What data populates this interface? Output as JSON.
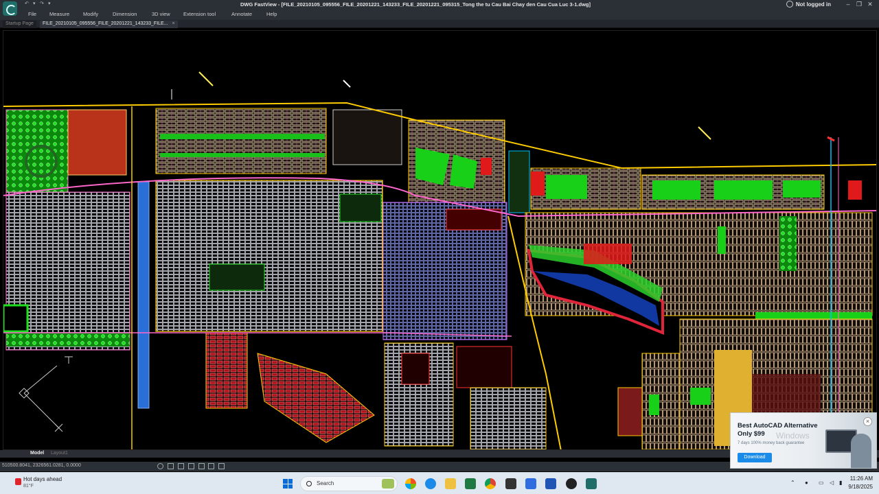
{
  "window": {
    "title": "DWG FastView - [FILE_20210105_095556_FILE_20201221_143233_FILE_20201221_095315_Tong the tu Cau Bai Chay den Cau Cua Luc 3-1.dwg]",
    "user_status": "Not logged in"
  },
  "menu": {
    "items": [
      "File",
      "Measure",
      "Modify",
      "Dimension",
      "3D view",
      "Extension tool",
      "Annotate",
      "Help"
    ]
  },
  "tabs": {
    "startup": "Startup Page",
    "active": "FILE_20210105_095556_FILE_20201221_143233_FILE...",
    "close_glyph": "×"
  },
  "layout_tabs": {
    "model": "Model",
    "layout": "Layout1"
  },
  "status": {
    "coordinates": "510500.8041, 2326561.0281, 0.0000"
  },
  "ad": {
    "title": "Best AutoCAD Alternative",
    "price": "Only $99",
    "watermark": "Windows",
    "subtitle": "7 days 100% money back guarantee",
    "button": "Download",
    "close_glyph": "×"
  },
  "taskbar": {
    "weather_title": "Hot days ahead",
    "weather_temp": "81°F",
    "search_placeholder": "Search",
    "time": "11:26 AM",
    "date": "9/18/2025"
  },
  "colors": {
    "cad_background": "#000000",
    "chrome": "#2b2f36",
    "taskbar": "#dfe7f1",
    "accent_blue": "#1a8be8"
  },
  "icons": [
    "app-logo-icon",
    "user-icon",
    "minimize-icon",
    "restore-icon",
    "close-icon",
    "weather-alert-icon",
    "windows-start-icon",
    "search-icon",
    "chevron-up-icon",
    "microphone-icon",
    "network-icon",
    "volume-icon"
  ]
}
